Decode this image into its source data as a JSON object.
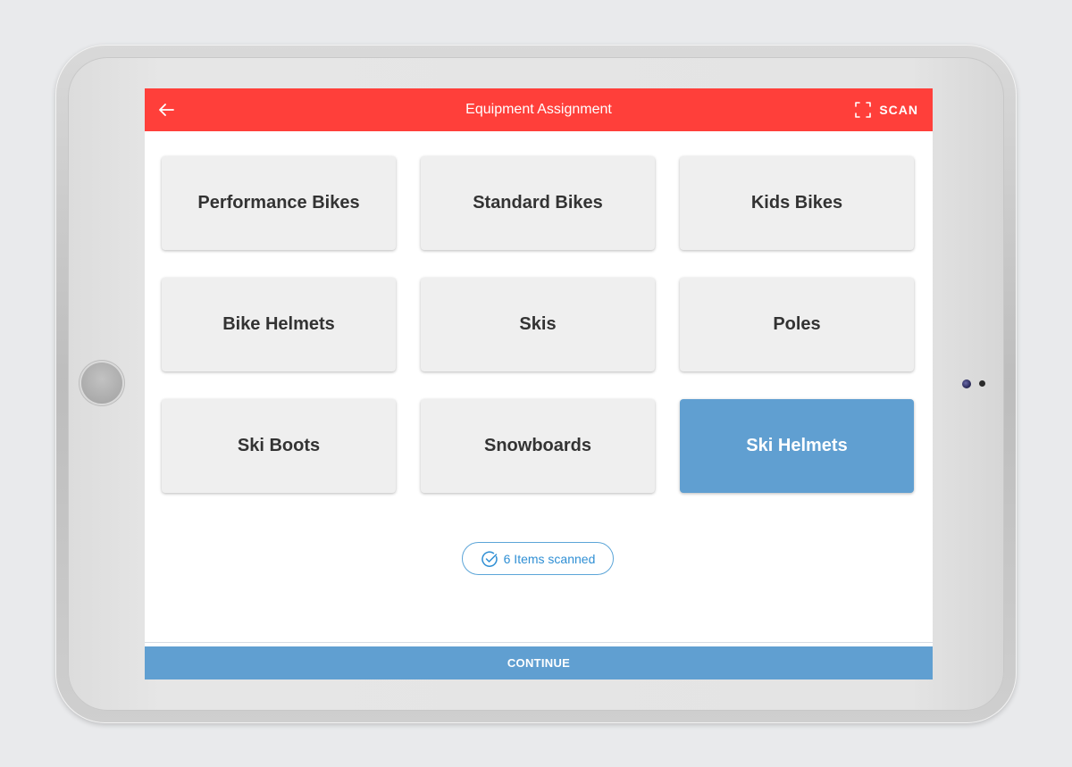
{
  "app_bar": {
    "back_icon": "arrow-left-icon",
    "title": "Equipment Assignment",
    "scan_icon": "scan-frame-icon",
    "scan_label": "SCAN",
    "color": "#ff3f3a"
  },
  "categories": [
    {
      "label": "Performance Bikes",
      "selected": false
    },
    {
      "label": "Standard Bikes",
      "selected": false
    },
    {
      "label": "Kids Bikes",
      "selected": false
    },
    {
      "label": "Bike Helmets",
      "selected": false
    },
    {
      "label": "Skis",
      "selected": false
    },
    {
      "label": "Poles",
      "selected": false
    },
    {
      "label": "Ski Boots",
      "selected": false
    },
    {
      "label": "Snowboards",
      "selected": false
    },
    {
      "label": "Ski Helmets",
      "selected": true
    }
  ],
  "status": {
    "icon": "check-circle-icon",
    "text": "6 Items scanned",
    "color": "#2f8fd4"
  },
  "footer": {
    "continue_label": "CONTINUE",
    "color": "#609fd1"
  }
}
